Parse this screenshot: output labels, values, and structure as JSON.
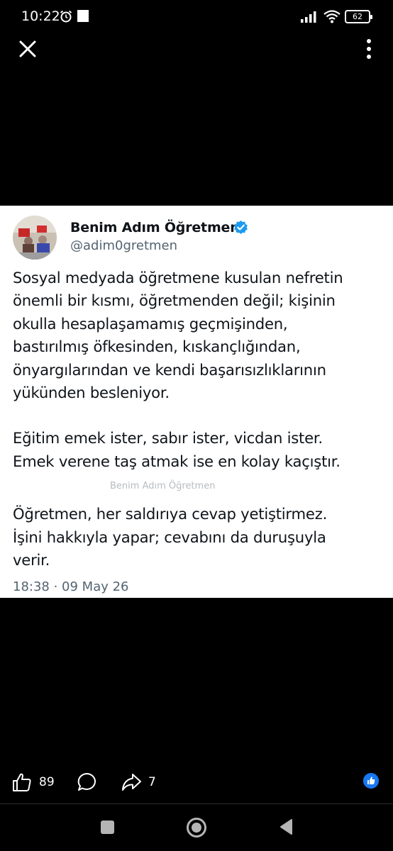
{
  "status_bar": {
    "time": "10:22",
    "battery": "62"
  },
  "tweet": {
    "author_name": "Benim Adım Öğretmen",
    "handle": "@adim0gretmen",
    "paragraphs": [
      "Sosyal medyada öğretmene kusulan nefretin\nönemli bir kısmı, öğretmenden değil; kişinin\nokulla hesaplaşamamış geçmişinden,\nbastırılmış öfkesinden, kıskançlığından,\nönyargılarından ve kendi başarısızlıklarının\nyükünden besleniyor.",
      "Eğitim emek ister, sabır ister, vicdan ister.\nEmek verene taş atmak ise en kolay kaçıştır.",
      "Öğretmen, her saldırıya cevap yetiştirmez.\nİşini hakkıyla yapar; cevabını da duruşuyla\nverir."
    ],
    "watermark": "Benim Adım Öğretmen",
    "timestamp": "18:38 · 09 May 26"
  },
  "actions": {
    "like_count": "89",
    "share_count": "7"
  },
  "icons": {
    "verified_color": "#1d9bf0",
    "reaction_color": "#1877f2"
  }
}
